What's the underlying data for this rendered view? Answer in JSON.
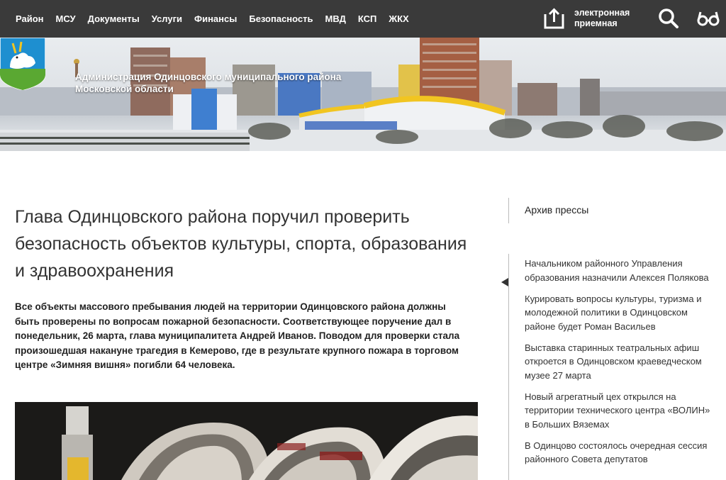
{
  "nav": {
    "items": [
      "Район",
      "МСУ",
      "Документы",
      "Услуги",
      "Финансы",
      "Безопасность",
      "МВД",
      "КСП",
      "ЖКХ"
    ],
    "reception_label": "электронная приемная"
  },
  "header": {
    "org_title": "Администрация Одинцовского муниципального района Московской области"
  },
  "article": {
    "title": "Глава Одинцовского района поручил проверить безопасность объектов культуры, спорта, образования и здравоохранения",
    "lead": "Все объекты массового пребывания людей на территории Одинцовского района должны быть проверены по вопросам пожарной безопасности. Соответствующее поручение дал в понедельник, 26 марта, глава муниципалитета Андрей Иванов. Поводом для проверки стала произошедшая накануне трагедия в Кемерово, где в результате крупного пожара в торговом центре «Зимняя вишня» погибли 64 человека."
  },
  "sidebar": {
    "archive_label": "Архив прессы",
    "news": [
      "Начальником районного Управления образования назначили Алексея Полякова",
      "Курировать вопросы культуры, туризма и молодежной политики в Одинцовском районе будет Роман Васильев",
      "Выставка старинных театральных афиш откроется в Одинцовском краеведческом музее 27 марта",
      "Новый агрегатный цех открылся на территории технического центра «ВОЛИН» в Больших Вяземах",
      "В Одинцово состоялось очередная сессия районного Совета депутатов"
    ]
  },
  "colors": {
    "topbar": "#3a3a3a",
    "crest_blue": "#1e8fd0",
    "crest_green": "#5aa832"
  }
}
